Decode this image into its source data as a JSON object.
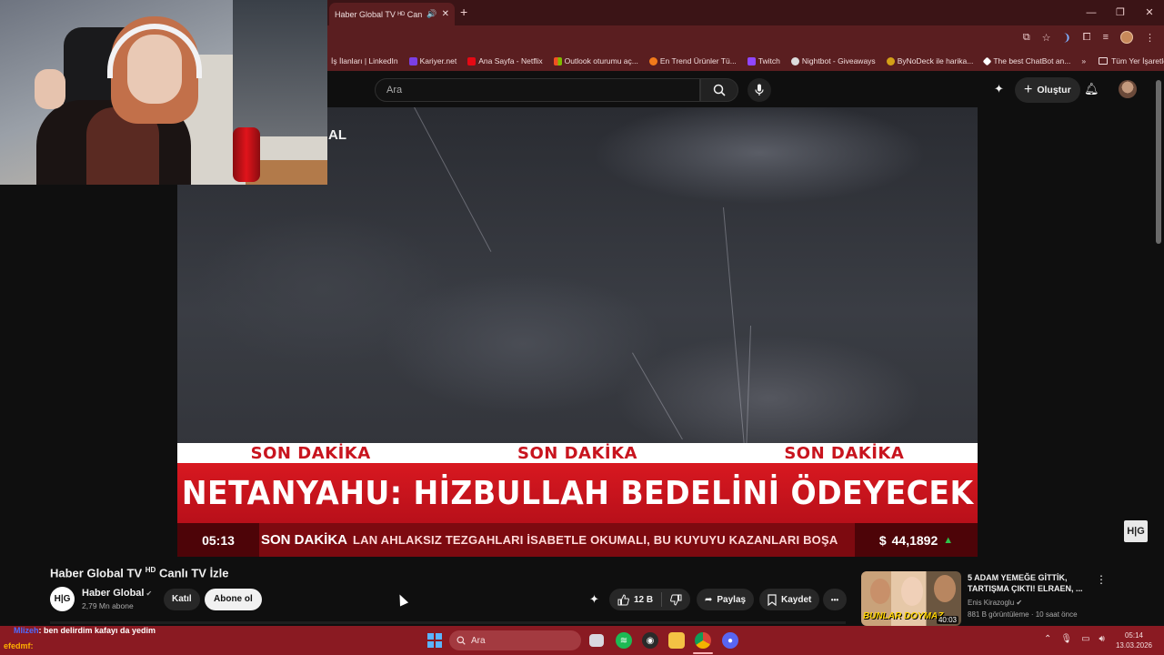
{
  "browser": {
    "tab_title": "Haber Global TV ᴴᴰ Canlı TV",
    "tab_close": "✕",
    "new_tab": "+",
    "window_controls": [
      "—",
      "❐",
      "✕"
    ]
  },
  "bookmarks": {
    "items": [
      {
        "label": "İş İlanları | LinkedIn",
        "color": "#5a1e20"
      },
      {
        "label": "Kariyer.net",
        "color": "#7b3fe4"
      },
      {
        "label": "Ana Sayfa - Netflix",
        "color": "#e50914"
      },
      {
        "label": "Outlook oturumu aç...",
        "color": "#f25022"
      },
      {
        "label": "En Trend Ürünler Tü...",
        "color": "#f27a1a"
      },
      {
        "label": "Twitch",
        "color": "#9146ff"
      },
      {
        "label": "Nightbot - Giveaways",
        "color": "#dcdcdc"
      },
      {
        "label": "ByNoDeck ile harika...",
        "color": "#d4a017"
      },
      {
        "label": "The best ChatBot an...",
        "color": "#ffffff"
      }
    ],
    "more": "»",
    "all_bookmarks": "Tüm Yer İşaretleri"
  },
  "youtube": {
    "search_placeholder": "Ara",
    "create_label": "Oluştur",
    "create_plus": "+"
  },
  "overlay": {
    "channel_fragment": "AL"
  },
  "video": {
    "son_dakika": [
      "SON DAKİKA",
      "SON DAKİKA",
      "SON DAKİKA"
    ],
    "headline": "NETANYAHU: HİZBULLAH BEDELİNİ ÖDEYECEK",
    "ticker_time": "05:13",
    "ticker_label": "SON DAKİKA",
    "ticker_text": "LAN AHLAKSIZ TEZGAHLARI İSABETLE OKUMALI, BU KUYUYU KAZANLARI BOŞA",
    "fx_symbol": "$",
    "fx_value": "44,1892",
    "fx_trend": "▲",
    "logo": "H|G"
  },
  "watch": {
    "title": "Haber Global TV",
    "title_hd": "HD",
    "title_suffix": "Canlı TV İzle",
    "channel_avatar": "H|G",
    "channel_name": "Haber Global",
    "verified": "✔",
    "subscribers": "2,79 Mn abone",
    "join_label": "Katıl",
    "subscribe_label": "Abone ol",
    "like_count": "12 B",
    "share_label": "Paylaş",
    "save_label": "Kaydet",
    "more_label": "•••"
  },
  "suggested": {
    "title": "5 ADAM YEMEĞE GİTTİK, TARTIŞMA ÇIKTI! ELRAEN, ...",
    "channel": "Enis Kirazoglu",
    "verified": "✔",
    "meta": "881 B görüntüleme · 10 saat önce",
    "duration": "40:03",
    "thumb_text": "BUNLAR DOYMAZ",
    "more": "⋮"
  },
  "chat": {
    "user1": "Mlizeh",
    "msg1": ": ben delirdim kafayı da yedim",
    "user2": "efedmf",
    "msg2": ":"
  },
  "taskbar": {
    "search_label": "Ara",
    "time": "05:14",
    "date": "13.03.2026"
  }
}
